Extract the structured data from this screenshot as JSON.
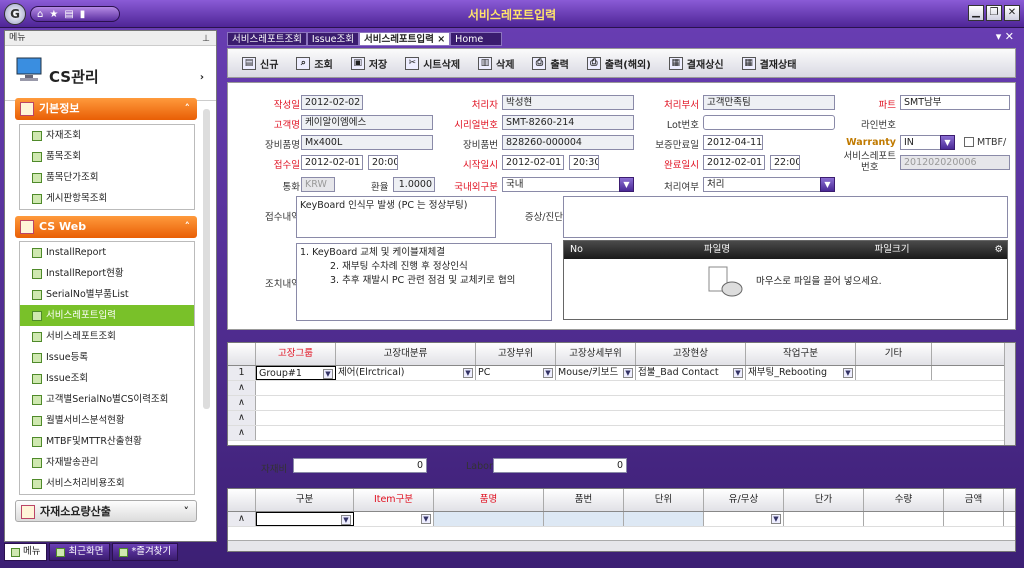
{
  "window": {
    "title": "서비스레포트입력"
  },
  "sidebar": {
    "header": "메뉴",
    "cs_title": "CS관리",
    "section1": {
      "title": "기본정보",
      "items": [
        "자재조회",
        "품목조회",
        "품목단가조회",
        "게시판항목조회"
      ]
    },
    "section2": {
      "title": "CS Web",
      "items": [
        "InstallReport",
        "InstallReport현황",
        "SerialNo별부품List",
        "서비스레포트입력",
        "서비스레포트조회",
        "Issue등록",
        "Issue조회",
        "고객별SerialNo별CS이력조회",
        "월별서비스분석현황",
        "MTBF및MTTR산출현황",
        "자재발송관리",
        "서비스처리비용조회"
      ]
    },
    "section3": {
      "title": "자재소요량산출"
    },
    "bottom_tabs": [
      "메뉴",
      "최근화면",
      "*즐겨찾기"
    ]
  },
  "tabs": [
    "서비스레포트조회",
    "Issue조회",
    "서비스레포트입력",
    "Home"
  ],
  "toolbar": [
    "신규",
    "조회",
    "저장",
    "시트삭제",
    "삭제",
    "출력",
    "출력(해외)",
    "결재상신",
    "결재상태"
  ],
  "form": {
    "작성일": "2012-02-02",
    "처리자": "박성현",
    "처리부서": "고객만족팀",
    "파트": "SMT남부",
    "고객명": "케이알이엠에스",
    "시리얼번호": "SMT-8260-214",
    "Lot번호": "",
    "라인번호": "",
    "장비품명": "Mx400L",
    "장비품번": "828260-000004",
    "보증만료일": "2012-04-11",
    "Warranty": "IN",
    "MTBF": "MTBF/",
    "접수일": "2012-02-01",
    "접수시간": "20:00",
    "시작일시": "2012-02-01",
    "시작시간": "20:30",
    "완료일시": "2012-02-01",
    "완료시간": "22:00",
    "서비스레포트번호": "201202020006",
    "통화": "KRW",
    "환율": "1.0000",
    "국내외구분": "국내",
    "처리여부": "처리",
    "접수내역": "KeyBoard 인식무 발생 (PC 는 정상부팅)",
    "조치내역": [
      "1. KeyBoard 교체 및 케이블재체결",
      "2. 재부팅 수차례 진행 후 정상인식",
      "3. 추후 재발시 PC 관련 점검 및 교체키로 협의"
    ],
    "labels": {
      "작성일": "작성일",
      "처리자": "처리자",
      "처리부서": "처리부서",
      "파트": "파트",
      "고객명": "고객명",
      "시리얼번호": "시리얼번호",
      "Lot번호": "Lot번호",
      "라인번호": "라인번호",
      "장비품명": "장비품명",
      "장비품번": "장비품번",
      "보증만료일": "보증만료일",
      "Warranty": "Warranty",
      "접수일": "접수일",
      "시작일시": "시작일시",
      "완료일시": "완료일시",
      "서비스레포트번호": "서비스레포트\n번호",
      "통화": "통화",
      "환율": "환율",
      "국내외구분": "국내외구분",
      "처리여부": "처리여부",
      "접수내역": "접수내역",
      "증상진단": "증상/진단",
      "조치내역": "조치내역"
    }
  },
  "files": {
    "headers": [
      "No",
      "파일명",
      "파일크기"
    ],
    "hint": "마우스로 파일을 끌어 넣으세요."
  },
  "grid1": {
    "headers": [
      "고장그룹",
      "고장대분류",
      "고장부위",
      "고장상세부위",
      "고장현상",
      "작업구분",
      "기타"
    ],
    "row": [
      "Group#1",
      "제어(Elrctrical)",
      "PC",
      "Mouse/키보드",
      "접불_Bad Contact",
      "재부팅_Rebooting",
      ""
    ],
    "rownum": "1"
  },
  "costs": {
    "자재비_label": "자재비",
    "자재비": "0",
    "labor_label": "Labor",
    "labor": "0"
  },
  "grid2": {
    "headers": [
      "구분",
      "Item구분",
      "품명",
      "품번",
      "단위",
      "유/무상",
      "단가",
      "수량",
      "금액"
    ]
  }
}
